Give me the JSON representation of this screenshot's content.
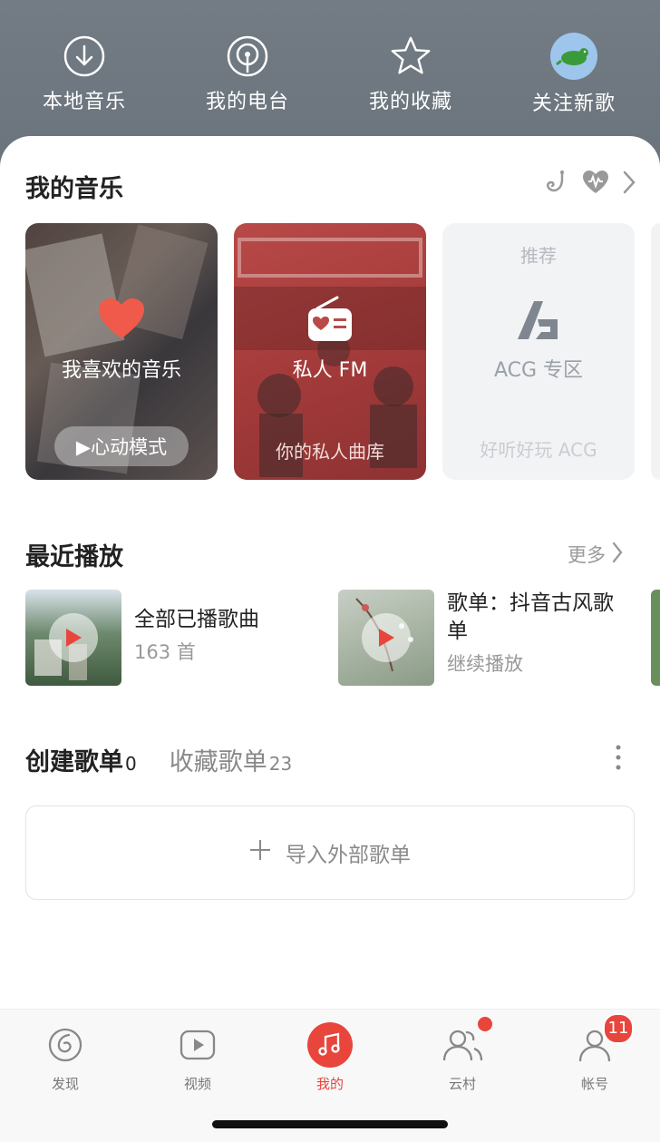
{
  "quick": [
    {
      "label": "本地音乐",
      "icon": "download-icon"
    },
    {
      "label": "我的电台",
      "icon": "radio-icon"
    },
    {
      "label": "我的收藏",
      "icon": "star-icon"
    },
    {
      "label": "关注新歌",
      "icon": "avatar-icon"
    }
  ],
  "my_music": {
    "title": "我的音乐",
    "tiles": [
      {
        "title": "我喜欢的音乐",
        "button": "▶心动模式"
      },
      {
        "title": "私人 FM",
        "subtitle": "你的私人曲库"
      },
      {
        "tag": "推荐",
        "title": "ACG 专区",
        "subtitle": "好听好玩 ACG"
      }
    ]
  },
  "recent": {
    "title": "最近播放",
    "more": "更多",
    "items": [
      {
        "title": "全部已播歌曲",
        "sub": "163 首"
      },
      {
        "title": "歌单：抖音古风歌单",
        "sub": "继续播放"
      }
    ]
  },
  "playlists": {
    "tab_created": "创建歌单",
    "created_count": "0",
    "tab_collected": "收藏歌单",
    "collected_count": "23",
    "import_label": "导入外部歌单"
  },
  "nav": [
    {
      "label": "发现"
    },
    {
      "label": "视频"
    },
    {
      "label": "我的"
    },
    {
      "label": "云村"
    },
    {
      "label": "帐号",
      "badge": "11"
    }
  ],
  "colors": {
    "accent": "#e8453c",
    "header": "#6f7880"
  }
}
